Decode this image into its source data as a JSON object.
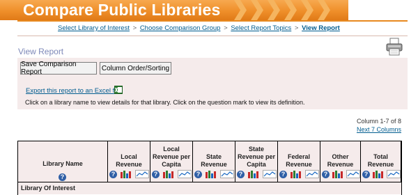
{
  "banner": {
    "title": "Compare Public Libraries"
  },
  "breadcrumb": [
    {
      "label": "Select Library of Interest"
    },
    {
      "label": "Choose Comparison Group"
    },
    {
      "label": "Select Report Topics"
    },
    {
      "label": "View Report"
    }
  ],
  "breadcrumb_separator": ">",
  "page": {
    "title": "View Report"
  },
  "toolbar": {
    "compare_label": "Save Comparison Report",
    "order_label": "Column Order/Sorting"
  },
  "export": {
    "link_label": "Export this report to an Excel file"
  },
  "instructions": "Click on a library name to view details for that library. Click on the question mark to view its definition.",
  "columns_info": {
    "range_text": "Column 1-7 of 8",
    "next_label": "Next 7 Columns"
  },
  "table": {
    "name_header": "Library Name",
    "headers": [
      "Local Revenue",
      "Local Revenue per Capita",
      "State Revenue",
      "State Revenue per Capita",
      "Federal Revenue",
      "Other Revenue",
      "Total Revenue"
    ],
    "row_label": "Library Of Interest"
  },
  "icons": {
    "printer": "printer-icon",
    "excel": "excel-icon",
    "help": "question-mark-icon",
    "bar_chart": "bar-chart-icon",
    "line_chart": "line-chart-icon"
  },
  "colors": {
    "banner_orange": "#ef8f2a",
    "link_blue": "#005c8f",
    "panel_bg": "#f5ebeb",
    "title_blue": "#7d88b8"
  }
}
